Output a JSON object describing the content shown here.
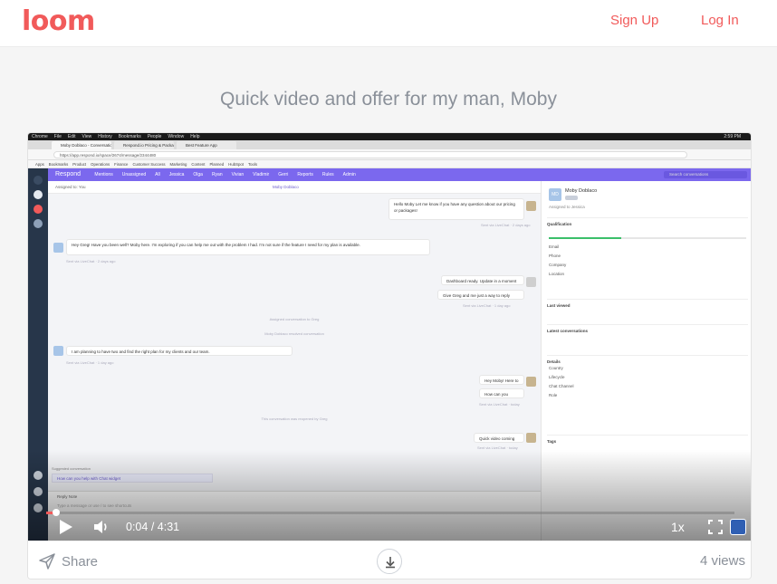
{
  "header": {
    "logo": "loom",
    "signup_label": "Sign Up",
    "login_label": "Log In"
  },
  "video": {
    "title": "Quick video and offer for my man, Moby"
  },
  "recording": {
    "mac_menu": [
      "Chrome",
      "File",
      "Edit",
      "View",
      "History",
      "Bookmarks",
      "People",
      "Window",
      "Help"
    ],
    "mac_status": "2:59 PM",
    "tabs": [
      "Moby Doblaco - Conversation",
      "Respond.io Pricing & Package",
      "Best Feature App"
    ],
    "url": "https://app.respond.io/space/2674/message/2344480",
    "bookmarks": [
      "Apps",
      "Bookmarks",
      "Product",
      "Operations",
      "Finance",
      "Customer Success",
      "Marketing",
      "Content",
      "Planned",
      "HubSpot",
      "Tools"
    ],
    "app_brand": "Respond",
    "nav_items": [
      "Mentions",
      "Unassigned",
      "All",
      "Jessica",
      "Olga",
      "Ryan",
      "Vivian",
      "Vladimir",
      "Gerri",
      "Reports",
      "Rules",
      "Admin"
    ],
    "search_placeholder": "Search conversations",
    "chat_header_left": "Assigned to: You",
    "chat_header_name": "Moby Doblaco",
    "messages": [
      {
        "side": "right",
        "text": "Hello Moby Let me know if you have any question about our pricing or packages!",
        "meta": "Sent via LiveChat · 2 days ago"
      },
      {
        "side": "left",
        "text": "Hey Greg! Have you been well? Moby here. I'm exploring if you can help me out with the problem I had. I'm not sure if the feature I need for my plan is available.",
        "meta": "Sent via LiveChat · 2 days ago"
      },
      {
        "side": "right",
        "text": "Dashboard ready. Update in a moment",
        "meta": ""
      },
      {
        "side": "right",
        "text": "Give Greg and me just a way to reply please",
        "meta": "Sent via LiveChat · 1 day ago"
      },
      {
        "side": "left",
        "text": "I am planning to have two and find the right plan for my clients and our team.",
        "meta": "Sent via LiveChat · 1 day ago"
      },
      {
        "side": "right",
        "text": "Hey Moby! Here to help",
        "meta": ""
      },
      {
        "side": "right",
        "text": "How can you help?",
        "meta": "Sent via LiveChat · today"
      },
      {
        "side": "right",
        "text": "Quick video coming",
        "meta": "Sent via LiveChat · today"
      }
    ],
    "system_lines": [
      "Assigned conversation to Greg",
      "Moby Doblaco resolved conversation",
      "This conversation was reopened by Greg"
    ],
    "suggest_label": "Suggested conversation",
    "suggest_text": "How can you help with Chat widget",
    "composer_tabs": "Reply   Note",
    "composer_placeholder": "Type a message or use / to see shortcuts",
    "profile": {
      "initials": "MD",
      "name": "Moby Doblaco",
      "subline": "Assigned to Jessica",
      "sections": [
        "Qualification",
        "Last viewed",
        "Latest conversations",
        "Details",
        "Tags"
      ],
      "fields": [
        "Email",
        "Phone",
        "Company",
        "Location",
        "Country",
        "Lifecycle",
        "Chat Channel",
        "Role"
      ]
    }
  },
  "player": {
    "current_time": "0:04",
    "separator": "/",
    "duration": "4:31",
    "speed": "1x",
    "progress": 0.015
  },
  "footer": {
    "share_label": "Share",
    "views": "4 views"
  },
  "colors": {
    "brand": "#f15a5a",
    "app_nav": "#7b68ee",
    "muted": "#8a9099"
  }
}
